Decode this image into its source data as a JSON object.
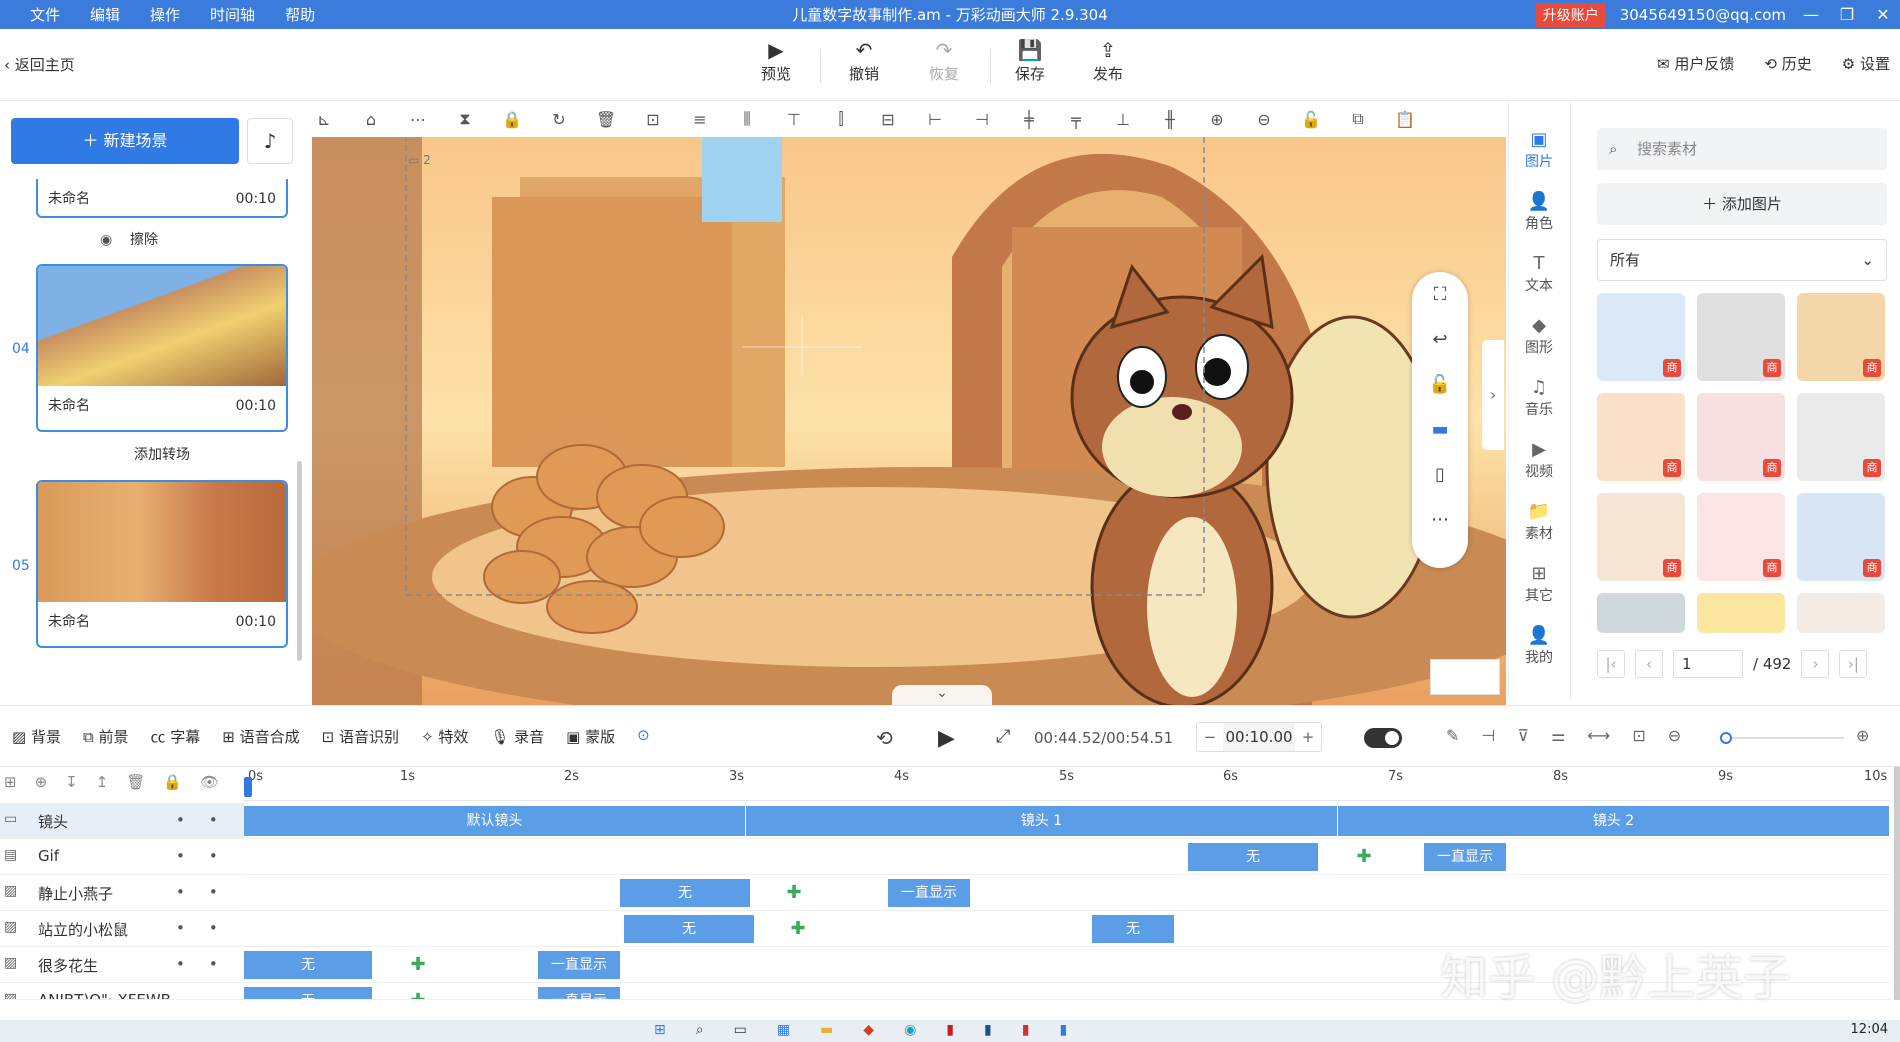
{
  "titlebar": {
    "menu": [
      "文件",
      "编辑",
      "操作",
      "时间轴",
      "帮助"
    ],
    "title": "儿童数字故事制作.am - 万彩动画大师 2.9.304",
    "upgrade": "升级账户",
    "account": "3045649150@qq.com"
  },
  "topbar": {
    "back": "返回主页",
    "preview": "预览",
    "undo": "撤销",
    "redo": "恢复",
    "save": "保存",
    "publish": "发布",
    "feedback": "用户反馈",
    "history": "历史",
    "settings": "设置"
  },
  "left": {
    "new_scene": "新建场景",
    "scenes": [
      {
        "num": "",
        "name": "未命名",
        "time": "00:10"
      },
      {
        "num": "04",
        "name": "未命名",
        "time": "00:10"
      },
      {
        "num": "05",
        "name": "未命名",
        "time": "00:10"
      }
    ],
    "wipe_label": "擦除",
    "add_transition": "添加转场"
  },
  "canvas": {
    "layer_label": "2"
  },
  "rightcol": [
    "图片",
    "角色",
    "文本",
    "图形",
    "音乐",
    "视频",
    "素材",
    "其它",
    "我的"
  ],
  "assets": {
    "search_placeholder": "搜索素材",
    "add_image": "添加图片",
    "filter": "所有",
    "badge": "商",
    "page": "1",
    "total": "/ 492"
  },
  "timeline_toolbar": {
    "buttons": [
      "背景",
      "前景",
      "字幕",
      "语音合成",
      "语音识别",
      "特效",
      "录音",
      "蒙版"
    ],
    "timecode": "00:44.52/00:54.51",
    "duration": "00:10.00"
  },
  "ruler": [
    "0s",
    "1s",
    "2s",
    "3s",
    "4s",
    "5s",
    "6s",
    "7s",
    "8s",
    "9s",
    "10s"
  ],
  "tracks": [
    {
      "name": "镜头"
    },
    {
      "name": "Gif"
    },
    {
      "name": "静止小燕子"
    },
    {
      "name": "站立的小松鼠"
    },
    {
      "name": "很多花生"
    },
    {
      "name": "ANIBT)O\"· XFEWB"
    }
  ],
  "camera_clips": [
    "默认镜头",
    "镜头 1",
    "镜头 2"
  ],
  "clip_labels": {
    "none": "无",
    "always": "一直显示",
    "always_cut": "一直显示"
  },
  "watermark": "知乎 @黔上英子",
  "clock": "12:04",
  "colors": {
    "accent": "#2f7ae5",
    "titlebar": "#3a7bdc",
    "clip": "#5b9de6",
    "keyframe": "#3aaa5a",
    "badge": "#e84a3c"
  }
}
